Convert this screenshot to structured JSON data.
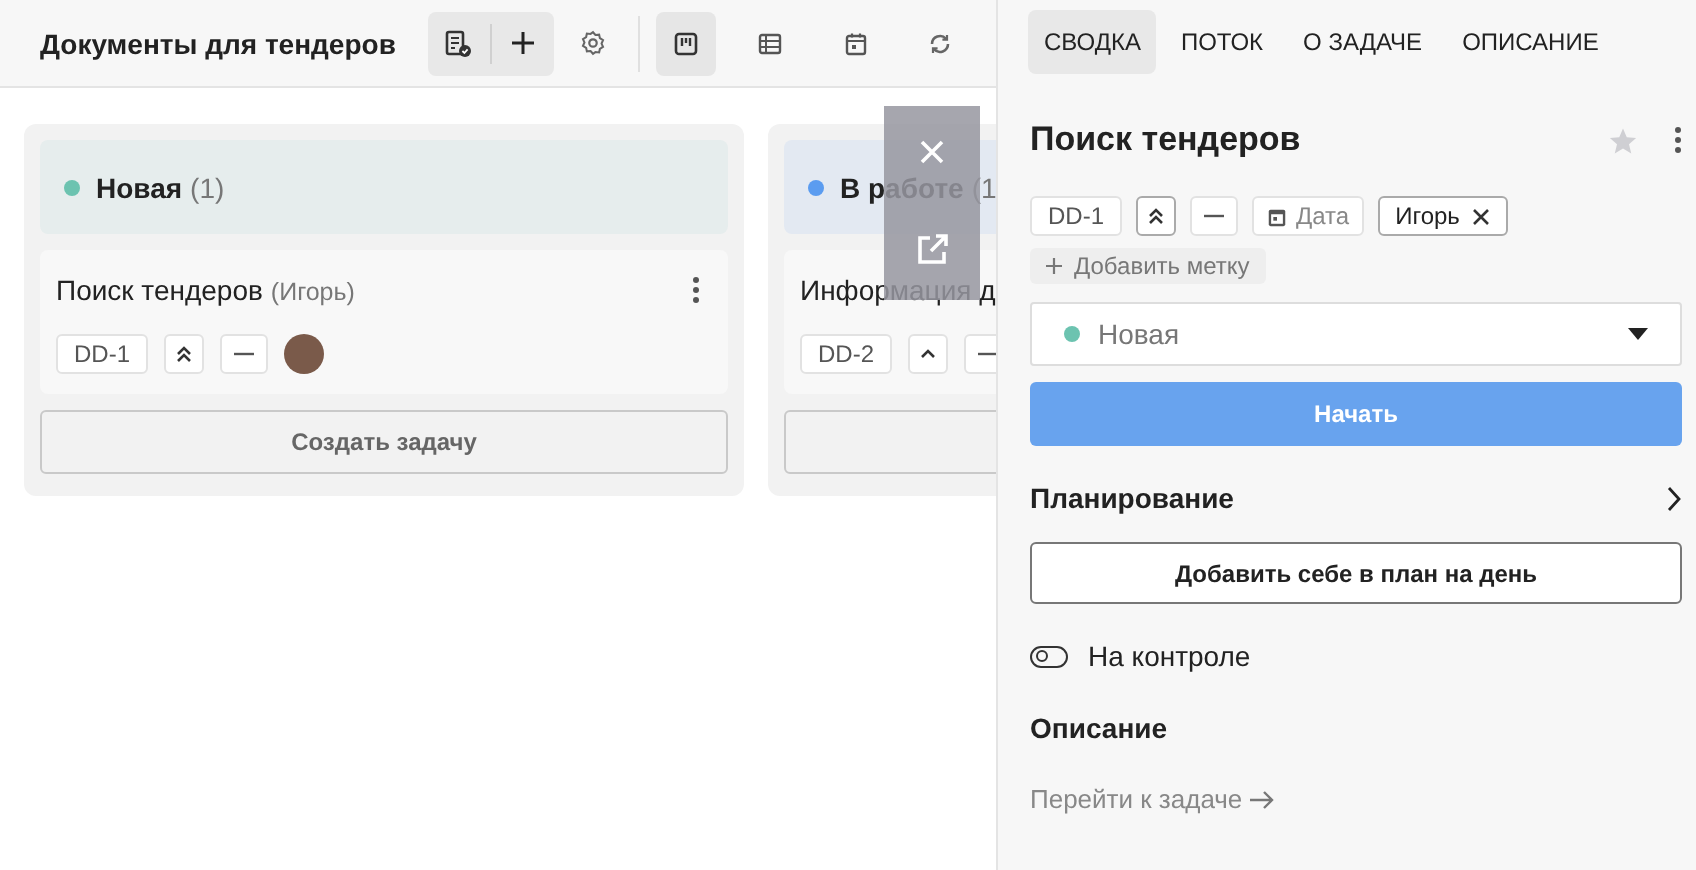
{
  "header": {
    "title": "Документы для тендеров",
    "view_buttons": [
      {
        "kind": "board",
        "selected": true
      },
      {
        "kind": "table",
        "selected": false
      },
      {
        "kind": "calendar",
        "selected": false
      },
      {
        "kind": "sync",
        "selected": false
      }
    ]
  },
  "columns": [
    {
      "title": "Новая",
      "count": "(1)",
      "color": "#6cc3b0",
      "cards": [
        {
          "title": "Поиск тендеров",
          "assignee": "(Игорь)",
          "chips": [
            {
              "kind": "code",
              "text": "DD-1"
            },
            {
              "kind": "priority_highest"
            },
            {
              "kind": "estimate"
            },
            {
              "kind": "avatar"
            }
          ]
        }
      ],
      "create_label": "Создать задачу"
    },
    {
      "title": "В работе",
      "count": "(1",
      "color": "#5b9cf0",
      "cards": [
        {
          "title": "Информация д",
          "chips": [
            {
              "kind": "code",
              "text": "DD-2"
            },
            {
              "kind": "priority_high"
            },
            {
              "kind": "estimate"
            }
          ]
        }
      ]
    }
  ],
  "panel": {
    "tabs": [
      {
        "label": "СВОДКА",
        "selected": true
      },
      {
        "label": "ПОТОК",
        "selected": false
      },
      {
        "label": "О ЗАДАЧЕ",
        "selected": false
      },
      {
        "label": "ОПИСАНИЕ",
        "selected": false
      }
    ],
    "title": "Поиск тендеров",
    "chips": [
      {
        "kind": "code",
        "text": "DD-1"
      },
      {
        "kind": "priority_highest"
      },
      {
        "kind": "estimate"
      },
      {
        "kind": "date",
        "placeholder": "Дата"
      },
      {
        "kind": "user",
        "text": "Игорь"
      }
    ],
    "add_tag": "Добавить метку",
    "status": {
      "label": "Новая",
      "color": "#6cc3b0"
    },
    "start_button": "Начать",
    "planning": "Планирование",
    "plan_button": "Добавить себе в план на день",
    "control": {
      "label": "На контроле",
      "on": false
    },
    "description": "Описание",
    "goto_link": "Перейти к задаче"
  }
}
